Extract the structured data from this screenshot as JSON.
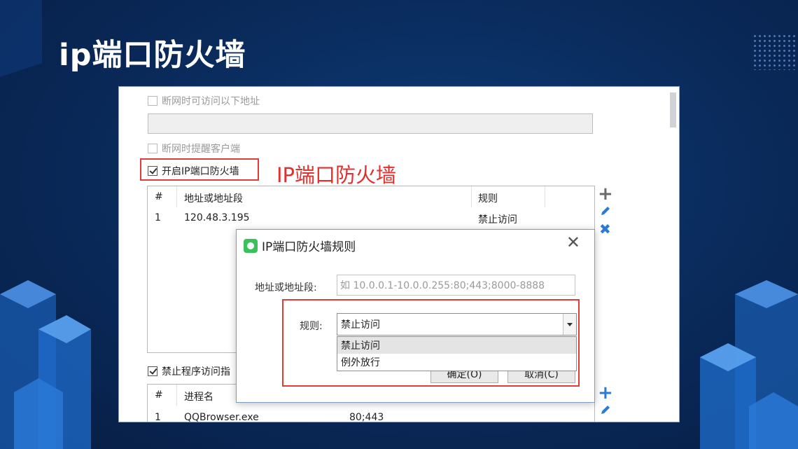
{
  "slide": {
    "title": "ip端口防火墙"
  },
  "settings": {
    "offline_access_label": "断网时可访问以下地址",
    "offline_remind_label": "断网时提醒客户端",
    "enable_firewall_label": "开启IP端口防火墙",
    "callout": "IP端口防火墙",
    "block_program_label": "禁止程序访问指"
  },
  "rules_table": {
    "columns": [
      "#",
      "地址或地址段",
      "规则"
    ],
    "rows": [
      {
        "num": "1",
        "address": "120.48.3.195",
        "rule": "禁止访问"
      }
    ]
  },
  "program_table": {
    "columns": [
      "#",
      "进程名"
    ],
    "rows": [
      {
        "num": "1",
        "name": "QQBrowser.exe",
        "ports": "80;443"
      }
    ]
  },
  "dialog": {
    "title": "IP端口防火墙规则",
    "address_label": "地址或地址段:",
    "address_placeholder": "如 10.0.0.1-10.0.0.255:80;443;8000-8888",
    "rule_label": "规则:",
    "rule_selected": "禁止访问",
    "rule_options": [
      "禁止访问",
      "例外放行"
    ],
    "ok_label": "确定(O)",
    "cancel_label": "取消(C)"
  },
  "colors": {
    "highlight": "#e23b3b",
    "icon_blue": "#2a7bd4",
    "background": "#0a2c5e"
  },
  "icons": {
    "add": "plus-icon",
    "edit": "pencil-icon",
    "delete": "close-icon"
  }
}
